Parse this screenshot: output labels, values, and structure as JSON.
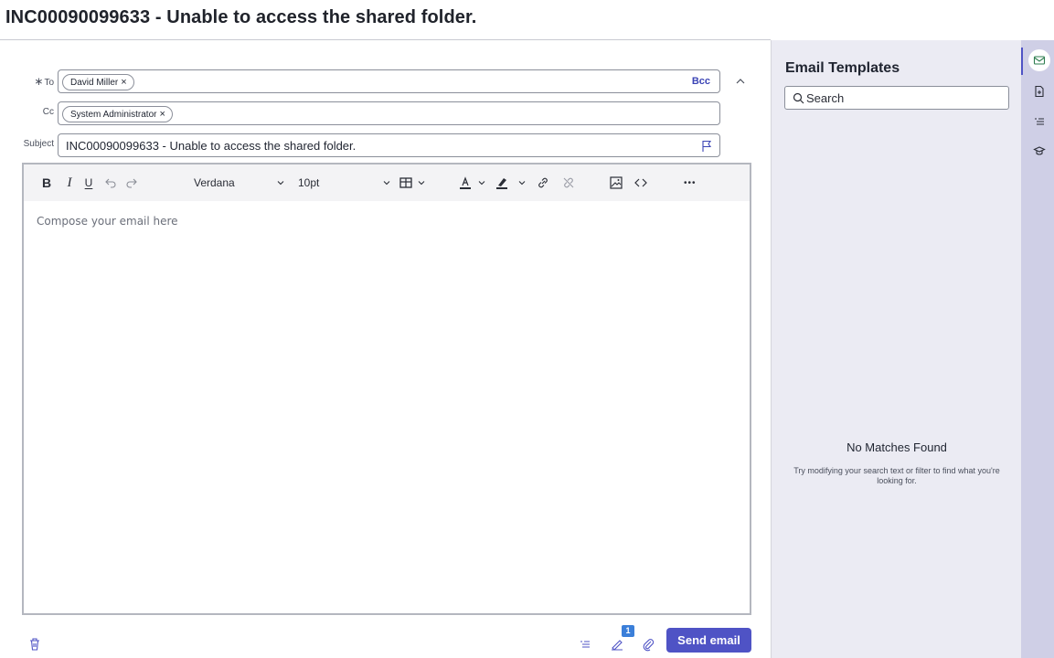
{
  "page": {
    "title": "INC00090099633 - Unable to access the shared folder."
  },
  "compose": {
    "to_label": "To",
    "required_marker": "∗",
    "to_recipients": [
      "David Miller"
    ],
    "bcc_label": "Bcc",
    "cc_label": "Cc",
    "cc_recipients": [
      "System Administrator"
    ],
    "subject_label": "Subject",
    "subject_value": "INC00090099633 - Unable to access the shared folder."
  },
  "toolbar": {
    "bold": "B",
    "italic": "I",
    "underline": "U",
    "font_family": "Verdana",
    "font_size": "10pt",
    "more": "•••"
  },
  "editor": {
    "placeholder": "Compose your email here"
  },
  "footer": {
    "signature_count": "1",
    "send_label": "Send email"
  },
  "templates": {
    "title": "Email Templates",
    "search_placeholder": "Search",
    "empty_title": "No Matches Found",
    "empty_message": "Try modifying your search text or filter to find what you're looking for."
  },
  "rail": {
    "items": [
      "email-templates-icon",
      "add-document-icon",
      "list-icon",
      "knowledge-cap-icon"
    ]
  },
  "colors": {
    "accent": "#4f53c5",
    "panel_bg": "#ebebf3",
    "rail_bg": "#cfcfe6",
    "badge": "#3b7fd9"
  }
}
